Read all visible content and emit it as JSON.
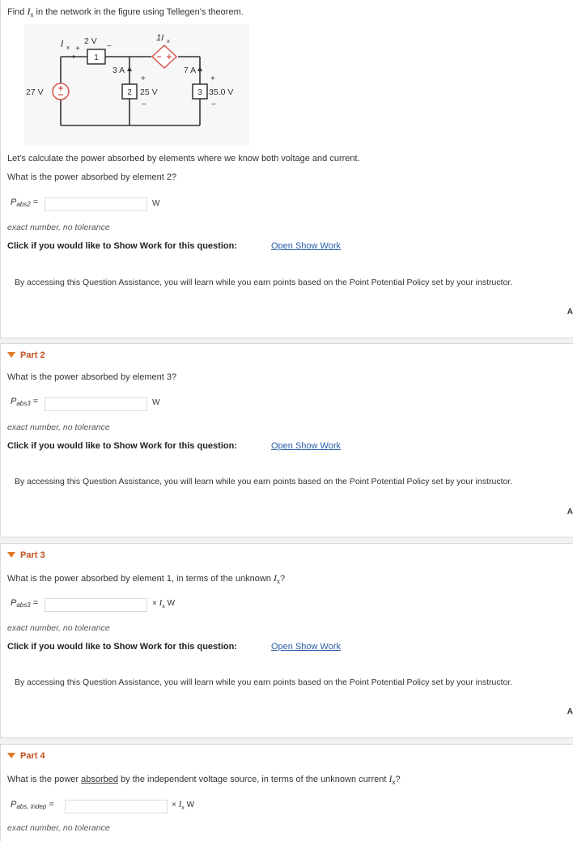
{
  "intro": {
    "question_prefix": "Find ",
    "question_var": "I",
    "question_var_sub": "x",
    "question_suffix": " in the network in the figure using Tellegen's theorem.",
    "circuit": {
      "source_27": "27 V",
      "ix_label": "I",
      "ix_sub": "x",
      "elem1_voltage": "2 V",
      "elem1_id": "1",
      "elem2_current": "3 A",
      "elem2_id": "2",
      "elem2_voltage": "25 V",
      "dep_source_label": "1I",
      "dep_source_sub": "x",
      "elem3_current": "7 A",
      "elem3_id": "3",
      "elem3_voltage": "35.0 V"
    },
    "context": "Let's calculate the power absorbed by elements where we know both voltage and current."
  },
  "parts": [
    {
      "title": "",
      "question": "What is the power absorbed by element 2?",
      "label_main": "P",
      "label_sub": "abs2",
      "eq": " =",
      "unit": "W",
      "hint": "exact number, no tolerance",
      "show_work_prompt": "Click if you would like to Show Work for this question:",
      "show_work_link": "Open Show Work",
      "assist": "By accessing this Question Assistance, you will learn while you earn points based on the Point Potential Policy set by your instructor.",
      "edge": "A"
    },
    {
      "title": "Part 2",
      "question": "What is the power absorbed by element 3?",
      "label_main": "P",
      "label_sub": "abs3",
      "eq": " =",
      "unit": "W",
      "hint": "exact number, no tolerance",
      "show_work_prompt": "Click if you would like to Show Work for this question:",
      "show_work_link": "Open Show Work",
      "assist": "By accessing this Question Assistance, you will learn while you earn points based on the Point Potential Policy set by your instructor.",
      "edge": "A"
    },
    {
      "title": "Part 3",
      "question": "What is the power absorbed by element 1, in terms of the unknown ",
      "question_var": "I",
      "question_var_sub": "x",
      "question_end": "?",
      "label_main": "P",
      "label_sub": "abs3",
      "eq": " =",
      "unit_prefix": "× ",
      "unit_var": "I",
      "unit_var_sub": "x",
      "unit": " W",
      "hint": "exact number, no tolerance",
      "show_work_prompt": "Click if you would like to Show Work for this question:",
      "show_work_link": "Open Show Work",
      "assist": "By accessing this Question Assistance, you will learn while you earn points based on the Point Potential Policy set by your instructor.",
      "edge": "A"
    },
    {
      "title": "Part 4",
      "question_pre": "What is the power ",
      "question_emph": "absorbed",
      "question_post": " by the independent voltage source, in terms of the unknown current ",
      "question_var": "I",
      "question_var_sub": "x",
      "question_end": "?",
      "label_main": "P",
      "label_sub": "abs, indep",
      "eq": " =",
      "unit_prefix": "× ",
      "unit_var": "I",
      "unit_var_sub": "x",
      "unit": " W",
      "hint": "exact number, no tolerance"
    }
  ],
  "colors": {
    "accent": "#e07a27",
    "part_title": "#c0501f",
    "link": "#2a5fa8",
    "circuit_red": "#d9534f"
  }
}
